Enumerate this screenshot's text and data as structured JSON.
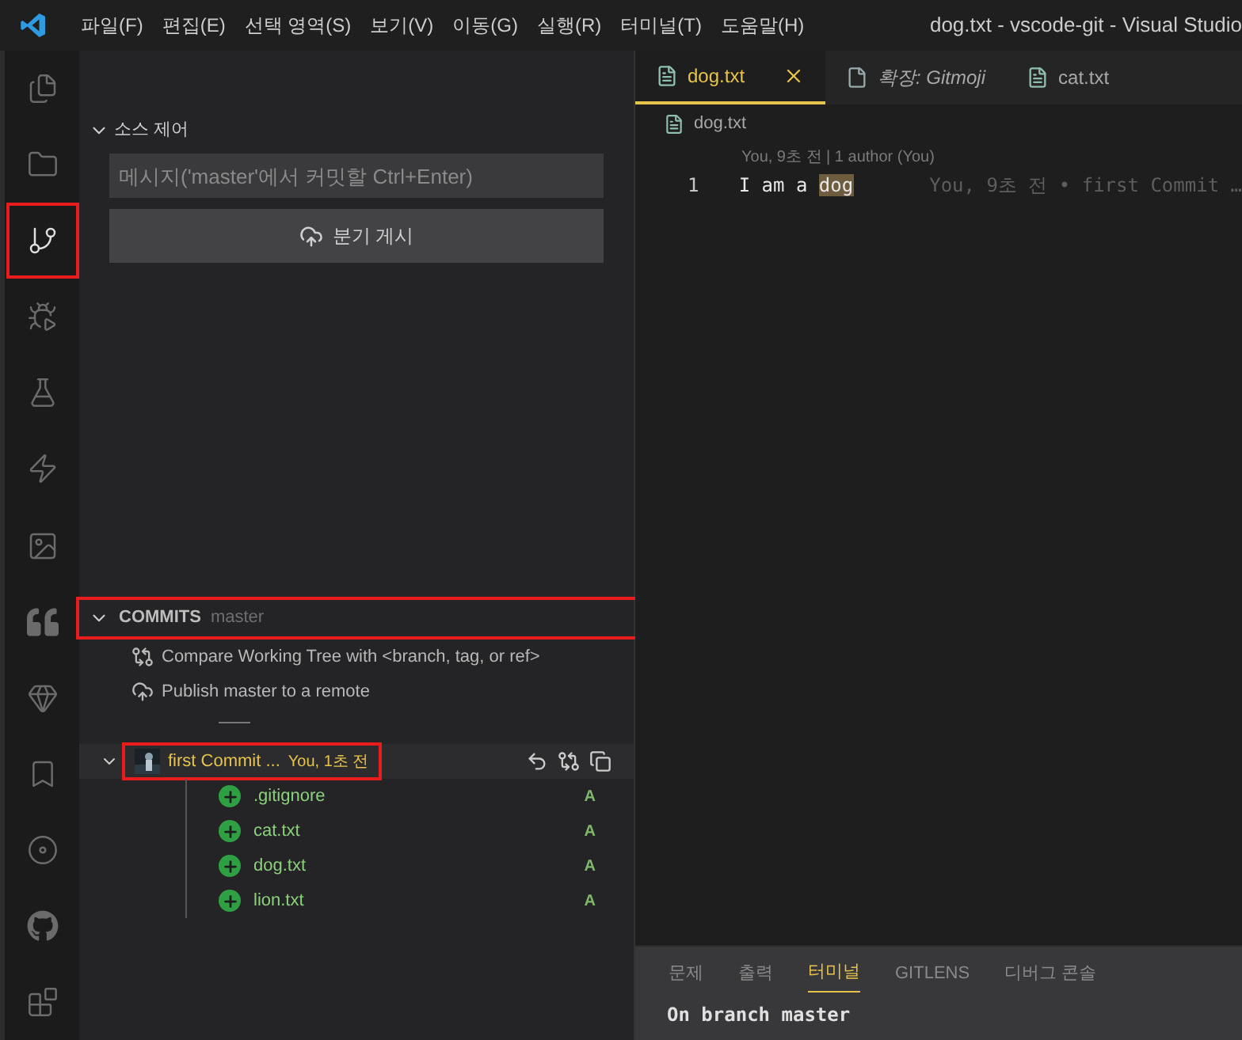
{
  "window": {
    "title": "dog.txt - vscode-git - Visual Studio"
  },
  "menu": [
    "파일(F)",
    "편집(E)",
    "선택 영역(S)",
    "보기(V)",
    "이동(G)",
    "실행(R)",
    "터미널(T)",
    "도움말(H)"
  ],
  "activity_bar": [
    {
      "selected": false,
      "annotated": false
    },
    {
      "selected": false,
      "annotated": false
    },
    {
      "selected": true,
      "annotated": true
    },
    {
      "selected": false,
      "annotated": false
    },
    {
      "selected": false,
      "annotated": false
    },
    {
      "selected": false,
      "annotated": false
    },
    {
      "selected": false,
      "annotated": false
    },
    {
      "selected": false,
      "annotated": false
    },
    {
      "selected": false,
      "annotated": false
    },
    {
      "selected": false,
      "annotated": false
    },
    {
      "selected": false,
      "annotated": false
    },
    {
      "selected": false,
      "annotated": false
    },
    {
      "selected": false,
      "annotated": false
    }
  ],
  "source_control": {
    "title": "소스 제어",
    "expanded": true,
    "commit_input": {
      "placeholder": "메시지('master'에서 커밋할 Ctrl+Enter)"
    },
    "publish_button": "분기 게시"
  },
  "commits": {
    "title": "COMMITS",
    "branch": "master",
    "expanded": true,
    "annotated": true,
    "actions": [
      {
        "kind": "compare",
        "label": "Compare Working Tree with <branch, tag, or ref>"
      },
      {
        "kind": "publish",
        "label": "Publish master to a remote"
      }
    ],
    "commit": {
      "message": "first Commit ...",
      "meta": "You, 1초 전",
      "expanded": true,
      "annotated": true,
      "files": [
        {
          "name": ".gitignore",
          "status": "A"
        },
        {
          "name": "cat.txt",
          "status": "A"
        },
        {
          "name": "dog.txt",
          "status": "A"
        },
        {
          "name": "lion.txt",
          "status": "A"
        }
      ]
    }
  },
  "tabs": [
    {
      "label": "dog.txt",
      "selected": true,
      "kind": "file"
    },
    {
      "label": "확장: Gitmoji",
      "selected": false,
      "kind": "preview"
    },
    {
      "label": "cat.txt",
      "selected": false,
      "kind": "file"
    }
  ],
  "breadcrumb": "dog.txt",
  "codelens": "You, 9초 전 | 1 author (You)",
  "lines": [
    {
      "number": "1",
      "text": "I am a ",
      "highlight": "dog",
      "blame": "You, 9초 전 • first Commit …"
    }
  ],
  "panel": {
    "tabs": [
      {
        "label": "문제",
        "selected": false
      },
      {
        "label": "출력",
        "selected": false
      },
      {
        "label": "터미널",
        "selected": true
      },
      {
        "label": "GITLENS",
        "selected": false
      },
      {
        "label": "디버그 콘솔",
        "selected": false
      }
    ],
    "terminal": [
      "On branch master"
    ]
  }
}
